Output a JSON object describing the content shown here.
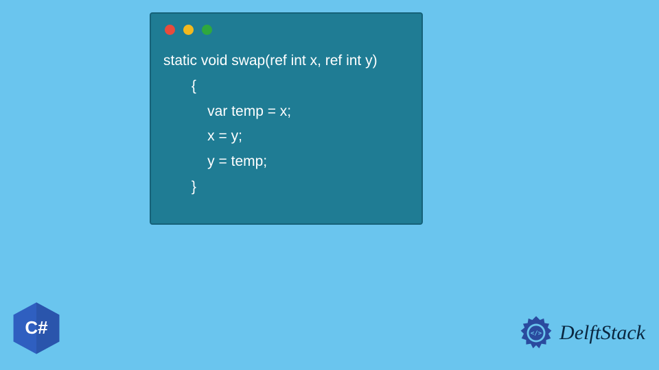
{
  "window": {
    "dots": [
      "red",
      "yellow",
      "green"
    ]
  },
  "code": {
    "lines": [
      "static void swap(ref int x, ref int y)",
      "       {",
      "           var temp = x;",
      "           x = y;",
      "           y = temp;",
      "       }"
    ]
  },
  "badge": {
    "label": "C#",
    "color": "#2f5fc0"
  },
  "brand": {
    "name": "DelftStack",
    "logo_color": "#2a4a9e"
  }
}
